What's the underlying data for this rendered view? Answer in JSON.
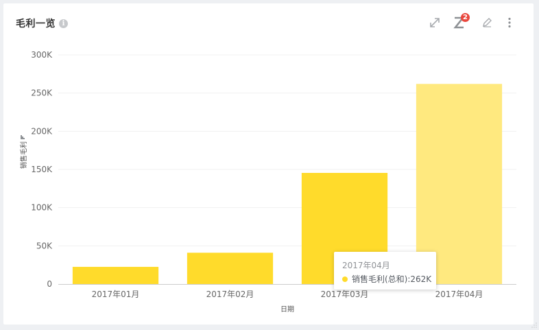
{
  "widget": {
    "title": "毛利一览",
    "badge_count": "2",
    "icons": [
      "info-icon",
      "expand-icon",
      "z-filter-icon",
      "edit-icon",
      "more-icon",
      "resize-grip-icon"
    ]
  },
  "colors": {
    "bar": "#ffdb2b",
    "bar_highlight": "#ffe97f",
    "axis_text": "#666666",
    "grid": "#f0f0f0"
  },
  "chart_data": {
    "type": "bar",
    "categories": [
      "2017年01月",
      "2017年02月",
      "2017年03月",
      "2017年04月"
    ],
    "series": [
      {
        "name": "销售毛利(总和)",
        "values": [
          22500,
          41000,
          145500,
          262000
        ]
      }
    ],
    "xlabel": "日期",
    "ylabel": "销售毛利",
    "ylim": [
      0,
      300000
    ],
    "yticks": [
      0,
      50000,
      100000,
      150000,
      200000,
      250000,
      300000
    ],
    "ytick_labels": [
      "0",
      "50K",
      "100K",
      "150K",
      "200K",
      "250K",
      "300K"
    ],
    "grid": true,
    "highlighted_category": "2017年04月"
  },
  "tooltip": {
    "title": "2017年04月",
    "series_name": "销售毛利(总和)",
    "value_label": "262K",
    "text": "销售毛利(总和):262K"
  }
}
